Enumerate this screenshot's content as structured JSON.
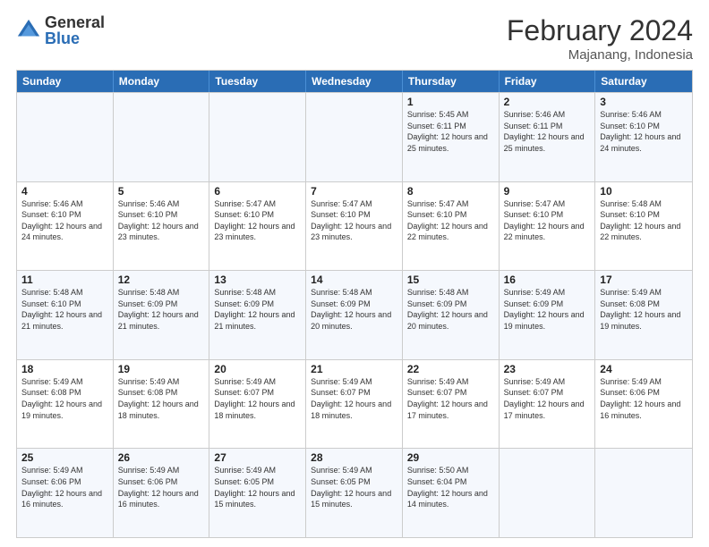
{
  "logo": {
    "general": "General",
    "blue": "Blue"
  },
  "header": {
    "title": "February 2024",
    "location": "Majanang, Indonesia"
  },
  "days": [
    "Sunday",
    "Monday",
    "Tuesday",
    "Wednesday",
    "Thursday",
    "Friday",
    "Saturday"
  ],
  "weeks": [
    [
      {
        "day": "",
        "sunrise": "",
        "sunset": "",
        "daylight": ""
      },
      {
        "day": "",
        "sunrise": "",
        "sunset": "",
        "daylight": ""
      },
      {
        "day": "",
        "sunrise": "",
        "sunset": "",
        "daylight": ""
      },
      {
        "day": "",
        "sunrise": "",
        "sunset": "",
        "daylight": ""
      },
      {
        "day": "1",
        "sunrise": "Sunrise: 5:45 AM",
        "sunset": "Sunset: 6:11 PM",
        "daylight": "Daylight: 12 hours and 25 minutes."
      },
      {
        "day": "2",
        "sunrise": "Sunrise: 5:46 AM",
        "sunset": "Sunset: 6:11 PM",
        "daylight": "Daylight: 12 hours and 25 minutes."
      },
      {
        "day": "3",
        "sunrise": "Sunrise: 5:46 AM",
        "sunset": "Sunset: 6:10 PM",
        "daylight": "Daylight: 12 hours and 24 minutes."
      }
    ],
    [
      {
        "day": "4",
        "sunrise": "Sunrise: 5:46 AM",
        "sunset": "Sunset: 6:10 PM",
        "daylight": "Daylight: 12 hours and 24 minutes."
      },
      {
        "day": "5",
        "sunrise": "Sunrise: 5:46 AM",
        "sunset": "Sunset: 6:10 PM",
        "daylight": "Daylight: 12 hours and 23 minutes."
      },
      {
        "day": "6",
        "sunrise": "Sunrise: 5:47 AM",
        "sunset": "Sunset: 6:10 PM",
        "daylight": "Daylight: 12 hours and 23 minutes."
      },
      {
        "day": "7",
        "sunrise": "Sunrise: 5:47 AM",
        "sunset": "Sunset: 6:10 PM",
        "daylight": "Daylight: 12 hours and 23 minutes."
      },
      {
        "day": "8",
        "sunrise": "Sunrise: 5:47 AM",
        "sunset": "Sunset: 6:10 PM",
        "daylight": "Daylight: 12 hours and 22 minutes."
      },
      {
        "day": "9",
        "sunrise": "Sunrise: 5:47 AM",
        "sunset": "Sunset: 6:10 PM",
        "daylight": "Daylight: 12 hours and 22 minutes."
      },
      {
        "day": "10",
        "sunrise": "Sunrise: 5:48 AM",
        "sunset": "Sunset: 6:10 PM",
        "daylight": "Daylight: 12 hours and 22 minutes."
      }
    ],
    [
      {
        "day": "11",
        "sunrise": "Sunrise: 5:48 AM",
        "sunset": "Sunset: 6:10 PM",
        "daylight": "Daylight: 12 hours and 21 minutes."
      },
      {
        "day": "12",
        "sunrise": "Sunrise: 5:48 AM",
        "sunset": "Sunset: 6:09 PM",
        "daylight": "Daylight: 12 hours and 21 minutes."
      },
      {
        "day": "13",
        "sunrise": "Sunrise: 5:48 AM",
        "sunset": "Sunset: 6:09 PM",
        "daylight": "Daylight: 12 hours and 21 minutes."
      },
      {
        "day": "14",
        "sunrise": "Sunrise: 5:48 AM",
        "sunset": "Sunset: 6:09 PM",
        "daylight": "Daylight: 12 hours and 20 minutes."
      },
      {
        "day": "15",
        "sunrise": "Sunrise: 5:48 AM",
        "sunset": "Sunset: 6:09 PM",
        "daylight": "Daylight: 12 hours and 20 minutes."
      },
      {
        "day": "16",
        "sunrise": "Sunrise: 5:49 AM",
        "sunset": "Sunset: 6:09 PM",
        "daylight": "Daylight: 12 hours and 19 minutes."
      },
      {
        "day": "17",
        "sunrise": "Sunrise: 5:49 AM",
        "sunset": "Sunset: 6:08 PM",
        "daylight": "Daylight: 12 hours and 19 minutes."
      }
    ],
    [
      {
        "day": "18",
        "sunrise": "Sunrise: 5:49 AM",
        "sunset": "Sunset: 6:08 PM",
        "daylight": "Daylight: 12 hours and 19 minutes."
      },
      {
        "day": "19",
        "sunrise": "Sunrise: 5:49 AM",
        "sunset": "Sunset: 6:08 PM",
        "daylight": "Daylight: 12 hours and 18 minutes."
      },
      {
        "day": "20",
        "sunrise": "Sunrise: 5:49 AM",
        "sunset": "Sunset: 6:07 PM",
        "daylight": "Daylight: 12 hours and 18 minutes."
      },
      {
        "day": "21",
        "sunrise": "Sunrise: 5:49 AM",
        "sunset": "Sunset: 6:07 PM",
        "daylight": "Daylight: 12 hours and 18 minutes."
      },
      {
        "day": "22",
        "sunrise": "Sunrise: 5:49 AM",
        "sunset": "Sunset: 6:07 PM",
        "daylight": "Daylight: 12 hours and 17 minutes."
      },
      {
        "day": "23",
        "sunrise": "Sunrise: 5:49 AM",
        "sunset": "Sunset: 6:07 PM",
        "daylight": "Daylight: 12 hours and 17 minutes."
      },
      {
        "day": "24",
        "sunrise": "Sunrise: 5:49 AM",
        "sunset": "Sunset: 6:06 PM",
        "daylight": "Daylight: 12 hours and 16 minutes."
      }
    ],
    [
      {
        "day": "25",
        "sunrise": "Sunrise: 5:49 AM",
        "sunset": "Sunset: 6:06 PM",
        "daylight": "Daylight: 12 hours and 16 minutes."
      },
      {
        "day": "26",
        "sunrise": "Sunrise: 5:49 AM",
        "sunset": "Sunset: 6:06 PM",
        "daylight": "Daylight: 12 hours and 16 minutes."
      },
      {
        "day": "27",
        "sunrise": "Sunrise: 5:49 AM",
        "sunset": "Sunset: 6:05 PM",
        "daylight": "Daylight: 12 hours and 15 minutes."
      },
      {
        "day": "28",
        "sunrise": "Sunrise: 5:49 AM",
        "sunset": "Sunset: 6:05 PM",
        "daylight": "Daylight: 12 hours and 15 minutes."
      },
      {
        "day": "29",
        "sunrise": "Sunrise: 5:50 AM",
        "sunset": "Sunset: 6:04 PM",
        "daylight": "Daylight: 12 hours and 14 minutes."
      },
      {
        "day": "",
        "sunrise": "",
        "sunset": "",
        "daylight": ""
      },
      {
        "day": "",
        "sunrise": "",
        "sunset": "",
        "daylight": ""
      }
    ]
  ]
}
